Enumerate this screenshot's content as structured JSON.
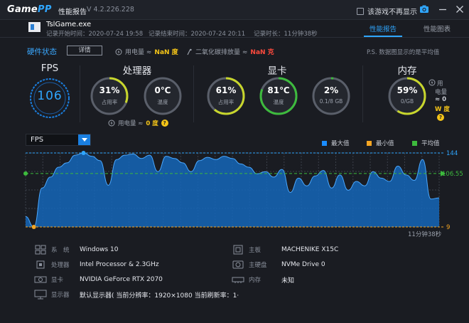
{
  "app": {
    "logo_main": "Game",
    "logo_accent": "PP",
    "title": "性能报告",
    "version": "V 4.2.226.228",
    "no_show_label": "该游戏不再显示"
  },
  "game": {
    "name": "TslGame.exe",
    "start_label": "记录开始时间：",
    "start_time": "2020-07-24 19:58",
    "end_label": "记录结束时间：",
    "end_time": "2020-07-24 20:11",
    "duration_label": "记录时长：",
    "duration": "11分钟38秒"
  },
  "tabs": [
    {
      "label": "性能报告",
      "active": true
    },
    {
      "label": "性能图表",
      "active": false
    }
  ],
  "status": {
    "title": "硬件状态",
    "details_label": "详情",
    "power_label": "用电量 ≈ ",
    "power_value": "NaN 度",
    "co2_label": "二氧化碳排放量 ≈ ",
    "co2_value": "NaN 克",
    "note": "P.S. 数据图显示的是平均值"
  },
  "fps_panel": {
    "title": "FPS",
    "value": "106"
  },
  "cpu": {
    "title": "处理器",
    "usage": {
      "value": "31%",
      "label": "占用率",
      "fraction": 0.31
    },
    "temp": {
      "value": "0℃",
      "label": "温度",
      "fraction": 0
    },
    "power_label": "用电量 ≈ ",
    "power_value": "0 度"
  },
  "gpu": {
    "title": "显卡",
    "usage": {
      "value": "61%",
      "label": "占用率",
      "fraction": 0.61
    },
    "temp": {
      "value": "81℃",
      "label": "温度",
      "fraction": 0.81
    },
    "mem": {
      "value": "2%",
      "label": "0.1/8 GB",
      "fraction": 0.02
    }
  },
  "memory": {
    "title": "内存",
    "usage": {
      "value": "59%",
      "label": "0/GB",
      "fraction": 0.59
    },
    "power_line1": "用",
    "power_line2": "电量",
    "power_line3": "≈ 0",
    "power_line4": "W 度"
  },
  "chart_controls": {
    "select_value": "FPS",
    "legend": [
      {
        "label": "最大值",
        "color": "#1a8cff"
      },
      {
        "label": "最小值",
        "color": "#f5a623"
      },
      {
        "label": "平均值",
        "color": "#3dbb3d"
      }
    ],
    "colors": {
      "fill": "#1566b8",
      "line": "#4aa8ff",
      "max": "#2fa6ff",
      "min": "#f5a623",
      "avg": "#3dbb3d"
    }
  },
  "chart_data": {
    "type": "area",
    "ylim": [
      9,
      144
    ],
    "max": 144,
    "min": 9,
    "avg": 106.55,
    "max_label": "144",
    "min_label": "9",
    "avg_label": "106.55",
    "x": [
      0,
      2,
      4,
      6,
      8,
      10,
      12,
      14,
      16,
      18,
      20,
      22,
      24,
      26,
      28,
      30,
      32,
      34,
      36,
      38,
      40,
      42,
      44,
      46,
      48,
      50,
      52,
      54,
      56,
      58,
      60,
      62,
      64,
      66,
      68,
      70,
      72,
      74,
      76,
      78,
      80,
      82,
      84,
      86,
      88,
      90,
      92,
      94,
      96,
      98,
      100
    ],
    "values": [
      28,
      9,
      80,
      100,
      118,
      126,
      140,
      144,
      138,
      130,
      85,
      132,
      140,
      142,
      134,
      140,
      110,
      138,
      134,
      126,
      110,
      130,
      136,
      132,
      138,
      134,
      124,
      118,
      106,
      110,
      100,
      114,
      72,
      98,
      84,
      102,
      112,
      80,
      104,
      76,
      92,
      84,
      110,
      98,
      92,
      120,
      104,
      94,
      132,
      60,
      62
    ],
    "xlabel": "",
    "ylabel": ""
  },
  "system_info": {
    "left": [
      {
        "label": "系　统",
        "value": "Windows 10",
        "icon": "windows-icon"
      },
      {
        "label": "处理器",
        "value": "Intel Processor & 2.3GHz",
        "icon": "cpu-icon"
      },
      {
        "label": "显卡",
        "value": "NVIDIA GeForce RTX 2070",
        "icon": "gpu-icon"
      },
      {
        "label": "显示器",
        "value": "默认显示器( 当前分辨率：1920×1080 当前刷新率：1·",
        "icon": "monitor-icon"
      }
    ],
    "right": [
      {
        "label": "主板",
        "value": "MACHENIKE X15C",
        "icon": "motherboard-icon"
      },
      {
        "label": "主硬盘",
        "value": "NVMe Drive 0",
        "icon": "harddisk-icon"
      },
      {
        "label": "内存",
        "value": "未知",
        "icon": "ram-icon"
      }
    ]
  }
}
